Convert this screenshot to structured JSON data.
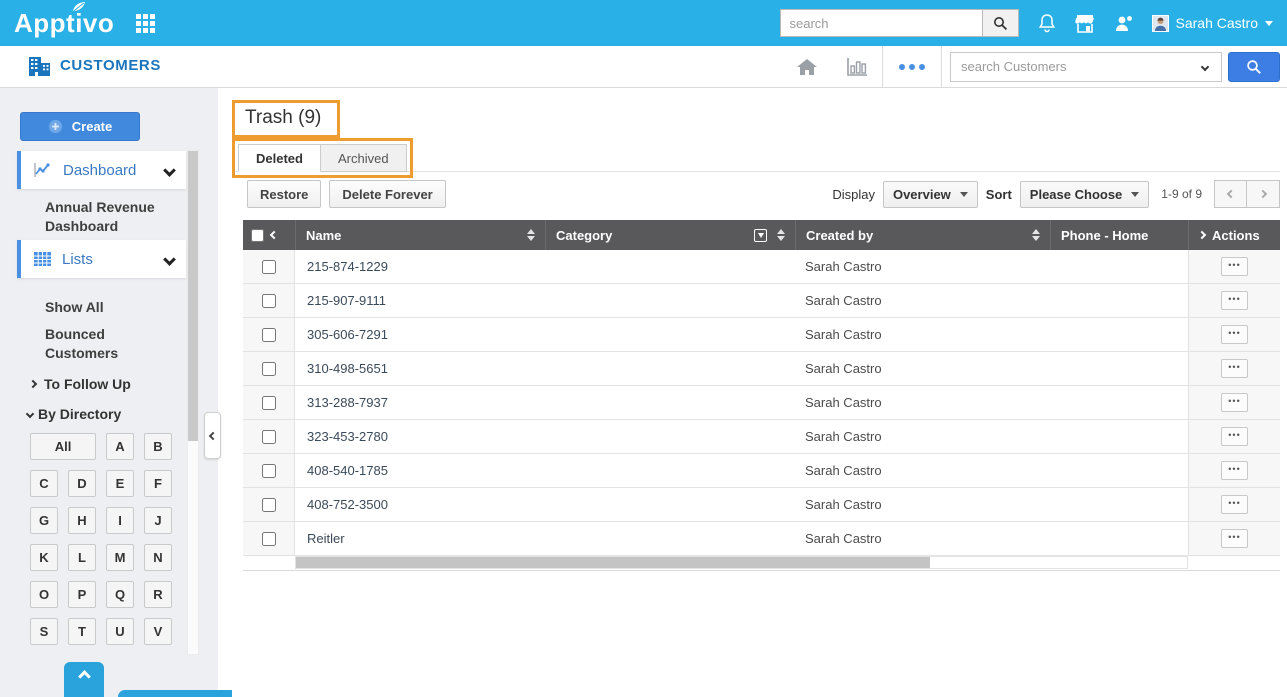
{
  "colors": {
    "topbar_bg": "#29b0e6",
    "accent_blue": "#3d7ee4",
    "link_blue": "#3b79c3",
    "brand_blue": "#1b75bc",
    "create_blue": "#4189dd",
    "table_header_bg": "#59595b",
    "annotation_orange": "#ee9b2f",
    "bottom_bar_blue": "#2aa3dc"
  },
  "topbar": {
    "logo": "Apptivo",
    "search_placeholder": "search",
    "user_name": "Sarah Castro"
  },
  "appbar": {
    "app_title": "CUSTOMERS",
    "search_placeholder": "search Customers"
  },
  "sidebar": {
    "create_label": "Create",
    "dashboard_label": "Dashboard",
    "annual_revenue_label": "Annual Revenue Dashboard",
    "lists_label": "Lists",
    "show_all_label": "Show All",
    "bounced_label": "Bounced Customers",
    "to_follow_up_label": "To Follow Up",
    "by_directory_label": "By Directory",
    "letters": [
      "All",
      "A",
      "B",
      "C",
      "D",
      "E",
      "F",
      "G",
      "H",
      "I",
      "J",
      "K",
      "L",
      "M",
      "N",
      "O",
      "P",
      "Q",
      "R",
      "S",
      "T",
      "U",
      "V"
    ]
  },
  "main": {
    "title": "Trash (9)",
    "tabs": [
      {
        "label": "Deleted"
      },
      {
        "label": "Archived"
      }
    ],
    "toolbar": {
      "restore": "Restore",
      "delete_forever": "Delete Forever",
      "display_label": "Display",
      "display_value": "Overview",
      "sort_label": "Sort",
      "sort_value": "Please Choose",
      "range": "1-9 of 9"
    },
    "table": {
      "columns": [
        "Name",
        "Category",
        "Created by",
        "Phone - Home",
        "Actions"
      ],
      "rows": [
        {
          "name": "215-874-1229",
          "category": "",
          "created_by": "Sarah Castro",
          "phone_home": ""
        },
        {
          "name": "215-907-9111",
          "category": "",
          "created_by": "Sarah Castro",
          "phone_home": ""
        },
        {
          "name": "305-606-7291",
          "category": "",
          "created_by": "Sarah Castro",
          "phone_home": ""
        },
        {
          "name": "310-498-5651",
          "category": "",
          "created_by": "Sarah Castro",
          "phone_home": ""
        },
        {
          "name": "313-288-7937",
          "category": "",
          "created_by": "Sarah Castro",
          "phone_home": ""
        },
        {
          "name": "323-453-2780",
          "category": "",
          "created_by": "Sarah Castro",
          "phone_home": ""
        },
        {
          "name": "408-540-1785",
          "category": "",
          "created_by": "Sarah Castro",
          "phone_home": ""
        },
        {
          "name": "408-752-3500",
          "category": "",
          "created_by": "Sarah Castro",
          "phone_home": ""
        },
        {
          "name": "Reitler",
          "category": "",
          "created_by": "Sarah Castro",
          "phone_home": ""
        }
      ]
    }
  }
}
